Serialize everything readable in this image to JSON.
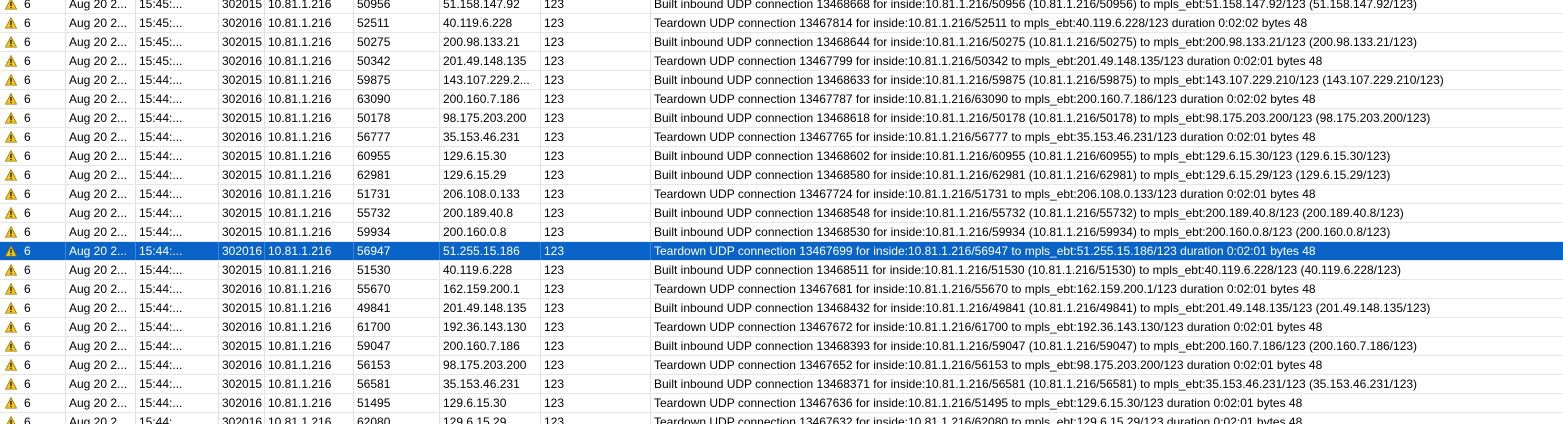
{
  "colors": {
    "selection": "#0a64c8",
    "warning": "#f5c518"
  },
  "rows": [
    {
      "icon": "warning-icon",
      "severity": "6",
      "date": "Aug 20 2...",
      "time": "15:45:...",
      "id": "302015",
      "src_ip": "10.81.1.216",
      "src_port": "50956",
      "dst_ip": "51.158.147.92",
      "dst_port": "123",
      "message": "Built inbound UDP connection 13468668 for inside:10.81.1.216/50956 (10.81.1.216/50956) to mpls_ebt:51.158.147.92/123 (51.158.147.92/123)"
    },
    {
      "icon": "warning-icon",
      "severity": "6",
      "date": "Aug 20 2...",
      "time": "15:45:...",
      "id": "302016",
      "src_ip": "10.81.1.216",
      "src_port": "52511",
      "dst_ip": "40.119.6.228",
      "dst_port": "123",
      "message": "Teardown UDP connection 13467814 for inside:10.81.1.216/52511 to mpls_ebt:40.119.6.228/123 duration 0:02:02 bytes 48"
    },
    {
      "icon": "warning-icon",
      "severity": "6",
      "date": "Aug 20 2...",
      "time": "15:45:...",
      "id": "302015",
      "src_ip": "10.81.1.216",
      "src_port": "50275",
      "dst_ip": "200.98.133.21",
      "dst_port": "123",
      "message": "Built inbound UDP connection 13468644 for inside:10.81.1.216/50275 (10.81.1.216/50275) to mpls_ebt:200.98.133.21/123 (200.98.133.21/123)"
    },
    {
      "icon": "warning-icon",
      "severity": "6",
      "date": "Aug 20 2...",
      "time": "15:45:...",
      "id": "302016",
      "src_ip": "10.81.1.216",
      "src_port": "50342",
      "dst_ip": "201.49.148.135",
      "dst_port": "123",
      "message": "Teardown UDP connection 13467799 for inside:10.81.1.216/50342 to mpls_ebt:201.49.148.135/123 duration 0:02:01 bytes 48"
    },
    {
      "icon": "warning-icon",
      "severity": "6",
      "date": "Aug 20 2...",
      "time": "15:44:...",
      "id": "302015",
      "src_ip": "10.81.1.216",
      "src_port": "59875",
      "dst_ip": "143.107.229.2...",
      "dst_port": "123",
      "message": "Built inbound UDP connection 13468633 for inside:10.81.1.216/59875 (10.81.1.216/59875) to mpls_ebt:143.107.229.210/123 (143.107.229.210/123)"
    },
    {
      "icon": "warning-icon",
      "severity": "6",
      "date": "Aug 20 2...",
      "time": "15:44:...",
      "id": "302016",
      "src_ip": "10.81.1.216",
      "src_port": "63090",
      "dst_ip": "200.160.7.186",
      "dst_port": "123",
      "message": "Teardown UDP connection 13467787 for inside:10.81.1.216/63090 to mpls_ebt:200.160.7.186/123 duration 0:02:02 bytes 48"
    },
    {
      "icon": "warning-icon",
      "severity": "6",
      "date": "Aug 20 2...",
      "time": "15:44:...",
      "id": "302015",
      "src_ip": "10.81.1.216",
      "src_port": "50178",
      "dst_ip": "98.175.203.200",
      "dst_port": "123",
      "message": "Built inbound UDP connection 13468618 for inside:10.81.1.216/50178 (10.81.1.216/50178) to mpls_ebt:98.175.203.200/123 (98.175.203.200/123)"
    },
    {
      "icon": "warning-icon",
      "severity": "6",
      "date": "Aug 20 2...",
      "time": "15:44:...",
      "id": "302016",
      "src_ip": "10.81.1.216",
      "src_port": "56777",
      "dst_ip": "35.153.46.231",
      "dst_port": "123",
      "message": "Teardown UDP connection 13467765 for inside:10.81.1.216/56777 to mpls_ebt:35.153.46.231/123 duration 0:02:01 bytes 48"
    },
    {
      "icon": "warning-icon",
      "severity": "6",
      "date": "Aug 20 2...",
      "time": "15:44:...",
      "id": "302015",
      "src_ip": "10.81.1.216",
      "src_port": "60955",
      "dst_ip": "129.6.15.30",
      "dst_port": "123",
      "message": "Built inbound UDP connection 13468602 for inside:10.81.1.216/60955 (10.81.1.216/60955) to mpls_ebt:129.6.15.30/123 (129.6.15.30/123)"
    },
    {
      "icon": "warning-icon",
      "severity": "6",
      "date": "Aug 20 2...",
      "time": "15:44:...",
      "id": "302015",
      "src_ip": "10.81.1.216",
      "src_port": "62981",
      "dst_ip": "129.6.15.29",
      "dst_port": "123",
      "message": "Built inbound UDP connection 13468580 for inside:10.81.1.216/62981 (10.81.1.216/62981) to mpls_ebt:129.6.15.29/123 (129.6.15.29/123)"
    },
    {
      "icon": "warning-icon",
      "severity": "6",
      "date": "Aug 20 2...",
      "time": "15:44:...",
      "id": "302016",
      "src_ip": "10.81.1.216",
      "src_port": "51731",
      "dst_ip": "206.108.0.133",
      "dst_port": "123",
      "message": "Teardown UDP connection 13467724 for inside:10.81.1.216/51731 to mpls_ebt:206.108.0.133/123 duration 0:02:01 bytes 48"
    },
    {
      "icon": "warning-icon",
      "severity": "6",
      "date": "Aug 20 2...",
      "time": "15:44:...",
      "id": "302015",
      "src_ip": "10.81.1.216",
      "src_port": "55732",
      "dst_ip": "200.189.40.8",
      "dst_port": "123",
      "message": "Built inbound UDP connection 13468548 for inside:10.81.1.216/55732 (10.81.1.216/55732) to mpls_ebt:200.189.40.8/123 (200.189.40.8/123)"
    },
    {
      "icon": "warning-icon",
      "severity": "6",
      "date": "Aug 20 2...",
      "time": "15:44:...",
      "id": "302015",
      "src_ip": "10.81.1.216",
      "src_port": "59934",
      "dst_ip": "200.160.0.8",
      "dst_port": "123",
      "message": "Built inbound UDP connection 13468530 for inside:10.81.1.216/59934 (10.81.1.216/59934) to mpls_ebt:200.160.0.8/123 (200.160.0.8/123)"
    },
    {
      "icon": "warning-icon",
      "severity": "6",
      "date": "Aug 20 2...",
      "time": "15:44:...",
      "id": "302016",
      "src_ip": "10.81.1.216",
      "src_port": "56947",
      "dst_ip": "51.255.15.186",
      "dst_port": "123",
      "message": "Teardown UDP connection 13467699 for inside:10.81.1.216/56947 to mpls_ebt:51.255.15.186/123 duration 0:02:01 bytes 48",
      "selected": true
    },
    {
      "icon": "warning-icon",
      "severity": "6",
      "date": "Aug 20 2...",
      "time": "15:44:...",
      "id": "302015",
      "src_ip": "10.81.1.216",
      "src_port": "51530",
      "dst_ip": "40.119.6.228",
      "dst_port": "123",
      "message": "Built inbound UDP connection 13468511 for inside:10.81.1.216/51530 (10.81.1.216/51530) to mpls_ebt:40.119.6.228/123 (40.119.6.228/123)"
    },
    {
      "icon": "warning-icon",
      "severity": "6",
      "date": "Aug 20 2...",
      "time": "15:44:...",
      "id": "302016",
      "src_ip": "10.81.1.216",
      "src_port": "55670",
      "dst_ip": "162.159.200.1",
      "dst_port": "123",
      "message": "Teardown UDP connection 13467681 for inside:10.81.1.216/55670 to mpls_ebt:162.159.200.1/123 duration 0:02:01 bytes 48"
    },
    {
      "icon": "warning-icon",
      "severity": "6",
      "date": "Aug 20 2...",
      "time": "15:44:...",
      "id": "302015",
      "src_ip": "10.81.1.216",
      "src_port": "49841",
      "dst_ip": "201.49.148.135",
      "dst_port": "123",
      "message": "Built inbound UDP connection 13468432 for inside:10.81.1.216/49841 (10.81.1.216/49841) to mpls_ebt:201.49.148.135/123 (201.49.148.135/123)"
    },
    {
      "icon": "warning-icon",
      "severity": "6",
      "date": "Aug 20 2...",
      "time": "15:44:...",
      "id": "302016",
      "src_ip": "10.81.1.216",
      "src_port": "61700",
      "dst_ip": "192.36.143.130",
      "dst_port": "123",
      "message": "Teardown UDP connection 13467672 for inside:10.81.1.216/61700 to mpls_ebt:192.36.143.130/123 duration 0:02:01 bytes 48"
    },
    {
      "icon": "warning-icon",
      "severity": "6",
      "date": "Aug 20 2...",
      "time": "15:44:...",
      "id": "302015",
      "src_ip": "10.81.1.216",
      "src_port": "59047",
      "dst_ip": "200.160.7.186",
      "dst_port": "123",
      "message": "Built inbound UDP connection 13468393 for inside:10.81.1.216/59047 (10.81.1.216/59047) to mpls_ebt:200.160.7.186/123 (200.160.7.186/123)"
    },
    {
      "icon": "warning-icon",
      "severity": "6",
      "date": "Aug 20 2...",
      "time": "15:44:...",
      "id": "302016",
      "src_ip": "10.81.1.216",
      "src_port": "56153",
      "dst_ip": "98.175.203.200",
      "dst_port": "123",
      "message": "Teardown UDP connection 13467652 for inside:10.81.1.216/56153 to mpls_ebt:98.175.203.200/123 duration 0:02:01 bytes 48"
    },
    {
      "icon": "warning-icon",
      "severity": "6",
      "date": "Aug 20 2...",
      "time": "15:44:...",
      "id": "302015",
      "src_ip": "10.81.1.216",
      "src_port": "56581",
      "dst_ip": "35.153.46.231",
      "dst_port": "123",
      "message": "Built inbound UDP connection 13468371 for inside:10.81.1.216/56581 (10.81.1.216/56581) to mpls_ebt:35.153.46.231/123 (35.153.46.231/123)"
    },
    {
      "icon": "warning-icon",
      "severity": "6",
      "date": "Aug 20 2...",
      "time": "15:44:...",
      "id": "302016",
      "src_ip": "10.81.1.216",
      "src_port": "51495",
      "dst_ip": "129.6.15.30",
      "dst_port": "123",
      "message": "Teardown UDP connection 13467636 for inside:10.81.1.216/51495 to mpls_ebt:129.6.15.30/123 duration 0:02:01 bytes 48"
    },
    {
      "icon": "warning-icon",
      "severity": "6",
      "date": "Aug 20 2...",
      "time": "15:44:...",
      "id": "302016",
      "src_ip": "10.81.1.216",
      "src_port": "62080",
      "dst_ip": "129.6.15.29",
      "dst_port": "123",
      "message": "Teardown UDP connection 13467632 for inside:10.81.1.216/62080 to mpls_ebt:129.6.15.29/123 duration 0:02:01 bytes 48"
    }
  ]
}
